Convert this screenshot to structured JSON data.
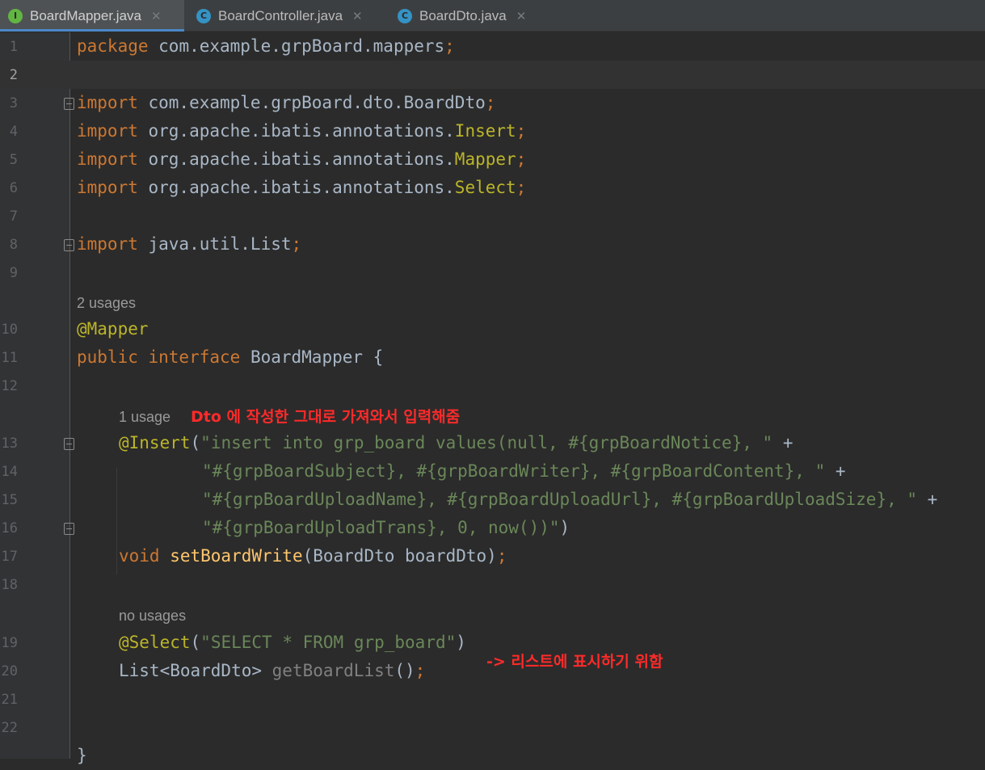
{
  "tabs": [
    {
      "icon": "I",
      "label": "BoardMapper.java",
      "active": true
    },
    {
      "icon": "C",
      "label": "BoardController.java",
      "active": false
    },
    {
      "icon": "C",
      "label": "BoardDto.java",
      "active": false
    }
  ],
  "close_glyph": "✕",
  "line_numbers": [
    "1",
    "2",
    "3",
    "4",
    "5",
    "6",
    "7",
    "8",
    "9",
    "10",
    "11",
    "12",
    "13",
    "14",
    "15",
    "16",
    "17",
    "18",
    "19",
    "20",
    "21",
    "22"
  ],
  "code": {
    "l1": {
      "kw": "package",
      "rest": " com.example.grpBoard.mappers",
      "semi": ";"
    },
    "l3": {
      "kw": "import",
      "rest": " com.example.grpBoard.dto.BoardDto",
      "semi": ";"
    },
    "l4": {
      "kw": "import",
      "rest": " org.apache.ibatis.annotations.",
      "cls": "Insert",
      "semi": ";"
    },
    "l5": {
      "kw": "import",
      "rest": " org.apache.ibatis.annotations.",
      "cls": "Mapper",
      "semi": ";"
    },
    "l6": {
      "kw": "import",
      "rest": " org.apache.ibatis.annotations.",
      "cls": "Select",
      "semi": ";"
    },
    "l8": {
      "kw": "import",
      "rest": " java.util.List",
      "semi": ";"
    },
    "l10": {
      "ann": "@Mapper"
    },
    "l11": {
      "kw1": "public",
      "kw2": " interface",
      "rest": " BoardMapper {"
    },
    "l13": {
      "ann": "@Insert",
      "open": "(",
      "str": "\"insert into grp_board values(null, #{grpBoardNotice}, \"",
      "plus": " +"
    },
    "l14": {
      "str": "\"#{grpBoardSubject}, #{grpBoardWriter}, #{grpBoardContent}, \"",
      "plus": " +"
    },
    "l15": {
      "str": "\"#{grpBoardUploadName}, #{grpBoardUploadUrl}, #{grpBoardUploadSize}, \"",
      "plus": " +"
    },
    "l16": {
      "str": "\"#{grpBoardUploadTrans}, 0, now())\"",
      "close": ")"
    },
    "l17": {
      "kw": "void",
      "fn": " setBoardWrite",
      "rest": "(BoardDto boardDto)",
      "semi": ";"
    },
    "l19": {
      "ann": "@Select",
      "open": "(",
      "str": "\"SELECT * FROM grp_board\"",
      "close": ")"
    },
    "l20": {
      "rest": "List<BoardDto> ",
      "dim": "getBoardList",
      "paren": "()",
      "semi": ";"
    },
    "l23": {
      "rest": "}"
    }
  },
  "usages": {
    "mapper": "2 usages",
    "insert": "1 usage",
    "select": "no usages"
  },
  "annotations": {
    "insert_note": "Dto 에 작성한 그대로 가져와서 입력해줌",
    "select_note": "-> 리스트에 표시하기 위함"
  },
  "colors": {
    "background": "#2b2b2b",
    "keyword": "#cc7832",
    "annotation": "#bbb529",
    "string": "#6a8759",
    "method": "#ffc66d",
    "note": "#ff2a2a"
  }
}
